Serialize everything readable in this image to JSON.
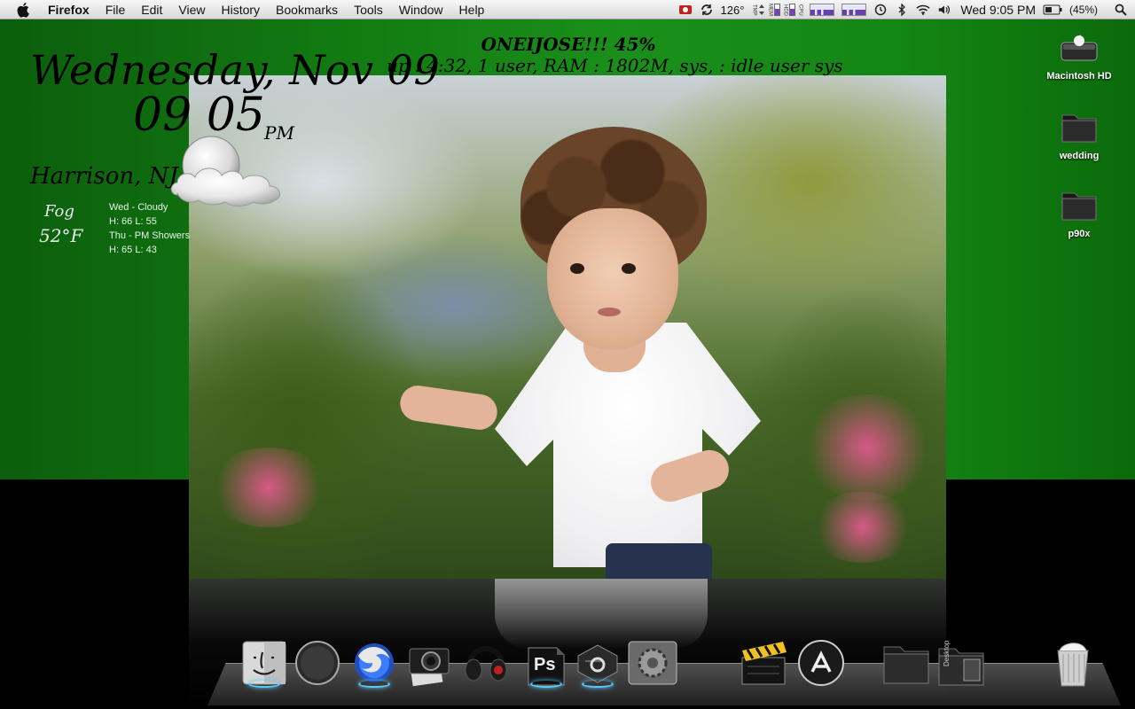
{
  "menubar": {
    "apple_icon": "apple-logo-icon",
    "app_name": "Firefox",
    "items": [
      "File",
      "Edit",
      "View",
      "History",
      "Bookmarks",
      "Tools",
      "Window",
      "Help"
    ],
    "temperature": "126°",
    "tmp_label": "TMP",
    "mem_label": "MEM",
    "hdd_label": "HDD",
    "cpu_label": "CPU",
    "clock": "Wed 9:05 PM",
    "battery": "(45%)",
    "icons": [
      "record-icon",
      "sync-icon",
      "time-machine-icon",
      "bluetooth-icon",
      "wifi-icon",
      "volume-icon",
      "battery-icon",
      "spotlight-icon"
    ]
  },
  "clock_widget": {
    "date": "Wednesday, Nov 09",
    "time": "09 05",
    "ampm": "PM",
    "location": "Harrison, NJ",
    "condition": "Fog",
    "temperature": "52°F",
    "forecast": [
      {
        "day": "Wed - Cloudy",
        "hl": "H: 66  L: 55"
      },
      {
        "day": "Thu - PM Showers",
        "hl": "H: 65  L: 43"
      }
    ],
    "weather_icon": "cloud-moon-icon"
  },
  "system_monitor": {
    "title": "ONEIJOSE!!! 45%",
    "line": "up : 4:32, 1 user, RAM : 1802M, sys, : idle user  sys"
  },
  "desktop_icons": [
    {
      "label": "Macintosh HD",
      "icon": "hard-drive-icon"
    },
    {
      "label": "wedding",
      "icon": "folder-icon"
    },
    {
      "label": "p90x",
      "icon": "folder-icon"
    }
  ],
  "dock": {
    "items": [
      "finder-icon",
      "safari-icon",
      "firefox-icon",
      "camera-icon",
      "headphones-icon",
      "photoshop-icon",
      "cinema-icon",
      "system-preferences-icon",
      "clapperboard-icon",
      "app-store-icon",
      "folder-icon",
      "desktop-folder-icon",
      "trash-icon"
    ],
    "desktop_folder_label": "Desktop",
    "photoshop_label": "Ps"
  },
  "colors": {
    "desktop_green": "#127a12",
    "dock_indicator": "#58c8ff"
  }
}
